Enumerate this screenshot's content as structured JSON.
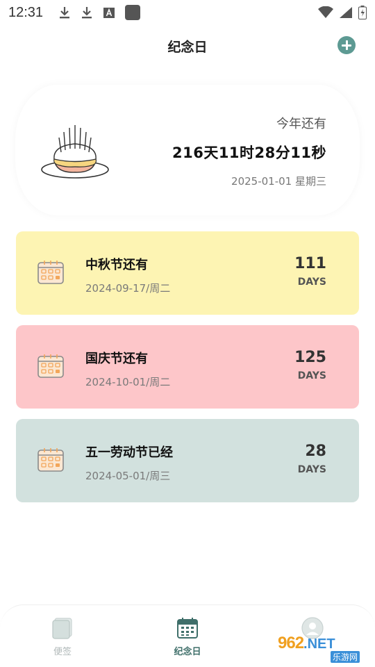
{
  "status_bar": {
    "time": "12:31",
    "left_icons": [
      "download-icon",
      "download-icon",
      "a-box-icon",
      "square-app-icon"
    ],
    "right_icons": [
      "wifi-icon",
      "signal-icon",
      "battery-icon"
    ]
  },
  "header": {
    "title": "纪念日",
    "add_icon": "plus-circle-icon",
    "accent_color": "#5d9a93"
  },
  "hero": {
    "label": "今年还有",
    "countdown": "216天11时28分11秒",
    "date": "2025-01-01 星期三",
    "illustration": "cake-icon"
  },
  "events": [
    {
      "title": "中秋节还有",
      "date": "2024-09-17/周二",
      "days": "111",
      "unit": "DAYS",
      "color": "#fdf4b3",
      "icon": "calendar-icon"
    },
    {
      "title": "国庆节还有",
      "date": "2024-10-01/周二",
      "days": "125",
      "unit": "DAYS",
      "color": "#fdc6c9",
      "icon": "calendar-icon"
    },
    {
      "title": "五一劳动节已经",
      "date": "2024-05-01/周三",
      "days": "28",
      "unit": "DAYS",
      "color": "#d2e1de",
      "icon": "calendar-icon"
    }
  ],
  "bottom_nav": {
    "items": [
      {
        "label": "便签",
        "icon": "notes-icon",
        "active": false
      },
      {
        "label": "纪念日",
        "icon": "calendar-icon",
        "active": true
      },
      {
        "label": "",
        "icon": "profile-icon",
        "active": false
      }
    ]
  },
  "watermark": {
    "brand": "962",
    "domain": ".NET",
    "sub": "乐游网"
  }
}
